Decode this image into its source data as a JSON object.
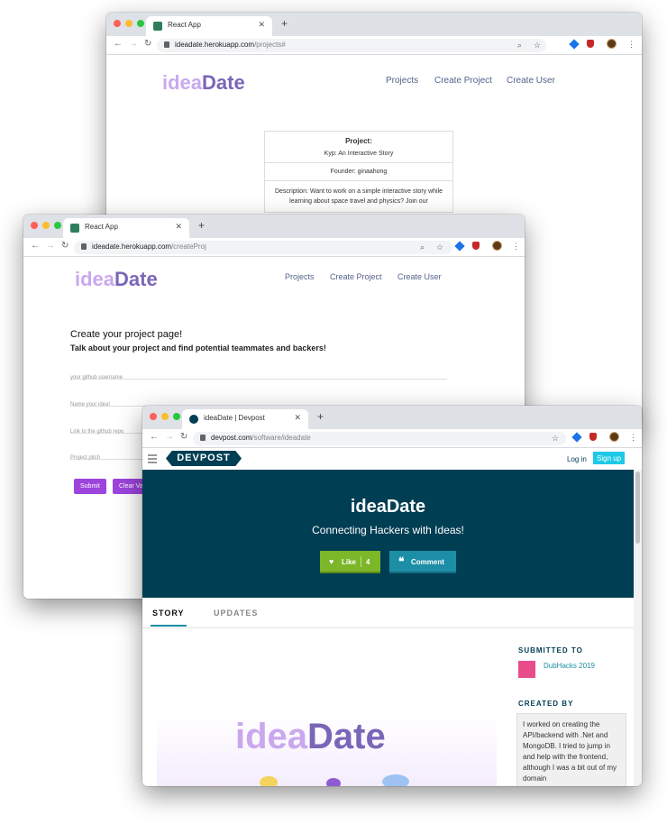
{
  "colors": {
    "logo_light": "#c9a8ee",
    "logo_dark": "#7a66b8",
    "devpost_navy": "#003e54",
    "like_green": "#7cb629",
    "comment_teal": "#1c8ea6",
    "purple_button": "#9c44dc"
  },
  "window_projects": {
    "tab_title": "React App",
    "url_host": "ideadate.herokuapp.com",
    "url_path": "/projects#",
    "logo_part1": "idea",
    "logo_part2": "Date",
    "nav": [
      "Projects",
      "Create Project",
      "Create User"
    ],
    "card": {
      "project_label": "Project:",
      "project_name": "Kyp: An Interactive Story",
      "founder": "Founder: ginaahong",
      "description": "Description: Want to work on a simple interactive story while learning about space travel and physics? Join our"
    }
  },
  "window_create": {
    "tab_title": "React App",
    "url_host": "ideadate.herokuapp.com",
    "url_path": "/createProj",
    "logo_part1": "idea",
    "logo_part2": "Date",
    "nav": [
      "Projects",
      "Create Project",
      "Create User"
    ],
    "heading": "Create your project page!",
    "subheading": "Talk about your project and find potential teammates and backers!",
    "placeholders": [
      "your github username",
      "Name your idea!",
      "Link to the github repo",
      "Project pitch"
    ],
    "submit_label": "Submit",
    "clear_label": "Clear Va"
  },
  "window_devpost": {
    "tab_title": "ideaDate | Devpost",
    "url_host": "devpost.com",
    "url_path": "/software/ideadate",
    "brand": "DEVPOST",
    "login": "Log in",
    "signup": "Sign up",
    "title": "ideaDate",
    "tagline": "Connecting Hackers with Ideas!",
    "like_label": "Like",
    "like_count": "4",
    "comment_label": "Comment",
    "tabs": [
      "STORY",
      "UPDATES"
    ],
    "submitted_to_heading": "SUBMITTED TO",
    "submitted_to": "DubHacks 2019",
    "created_by_heading": "CREATED BY",
    "created_by_text": "I worked on creating the API/backend with .Net and MongoDB. I tried to jump in and help with the frontend, although I was a bit out of my domain",
    "banner_logo_part1": "idea",
    "banner_logo_part2": "Date"
  }
}
